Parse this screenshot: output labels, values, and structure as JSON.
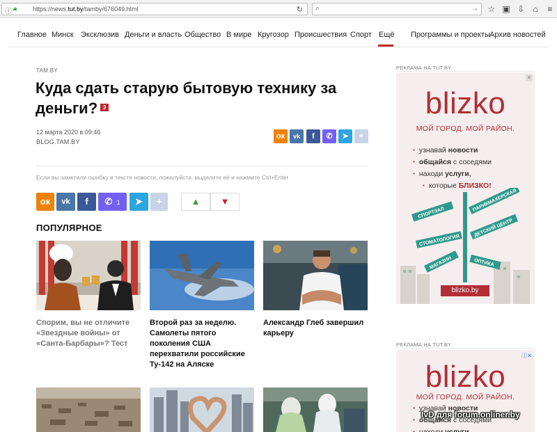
{
  "browser": {
    "url_prefix": "https://news.",
    "url_domain": "tut.by",
    "url_path": "/tamby/676049.html",
    "info_icon": "info-icon",
    "lock_icon": "lock-icon",
    "reload_icon": "reload-icon",
    "search_placeholder": "",
    "toolbar_icons": [
      "star-icon",
      "reader-icon",
      "download-icon",
      "home-icon",
      "menu-icon"
    ]
  },
  "nav": {
    "items": [
      "Главное",
      "Минск",
      "Эксклюзив",
      "Деньги и власть",
      "Общество",
      "В мире",
      "Кругозор",
      "Происшествия",
      "Спорт",
      "Ещё",
      "Программы и проекты",
      "Архив новостей"
    ],
    "active": "Ещё"
  },
  "article": {
    "source_tag": "TAM.BY",
    "title": "Куда сдать старую бытовую технику за деньги?",
    "comments_count": "3",
    "date": "12 марта 2020 в 09:46",
    "source": "BLOG.TAM.BY",
    "typo_note": "Если вы заметили ошибку в тексте новости, пожалуйста, выделите её и нажмите Ctrl+Enter",
    "viber_count": "1"
  },
  "share": {
    "ok": "ok-icon",
    "vk": "vk-icon",
    "fb": "facebook-icon",
    "viber": "viber-icon",
    "telegram": "telegram-icon",
    "more": "plus-icon",
    "colors": {
      "ok": "#ee8208",
      "vk": "#4a76a8",
      "fb": "#3b5998",
      "viber": "#7360f2",
      "telegram": "#2ca5e0",
      "more": "#c8d3e6"
    }
  },
  "popular": {
    "title": "ПОПУЛЯРНОЕ",
    "cards": [
      {
        "title": "Спорим, вы не отличите «Звездные войны» от «Санта-Барбары»? Тест",
        "muted": true
      },
      {
        "title": "Второй раз за неделю. Самолеты пятого поколения США перехватили российские Ту-142 на Аляске",
        "muted": false
      },
      {
        "title": "Александр Глеб завершил карьеру",
        "muted": false
      }
    ]
  },
  "ads": {
    "label": "РЕКЛАМА НА TUT.BY",
    "logo": "blizko",
    "tagline": "МОЙ ГОРОД. МОЙ РАЙОН.",
    "line1_pre": "узнавай ",
    "line1_bold": "новости",
    "line2_bold": "общайся",
    "line2_post": " с соседями",
    "line3_pre": "находи ",
    "line3_bold": "услуги,",
    "line4_pre": "которые ",
    "line4_red": "БЛИЗКО!",
    "signs": [
      "СПОРТЗАЛ",
      "ПАРИКМАХЕРСКАЯ",
      "СТОМАТОЛОГИЯ",
      "ДЕТСКИЙ ЦЕНТР",
      "МАГАЗИН",
      "ОПТИКА"
    ],
    "button": "blizko.by",
    "close": "×"
  },
  "watermark": "IvD для forum.onliner.by"
}
